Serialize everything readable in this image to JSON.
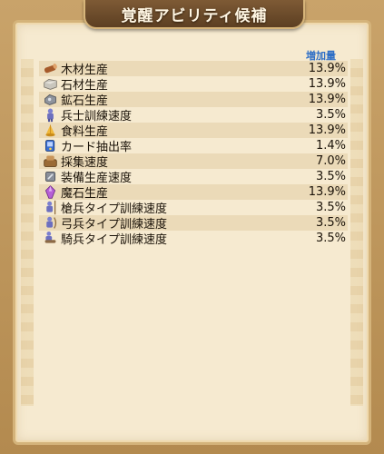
{
  "title": "覚醒アビリティ候補",
  "column_header": "増加量",
  "items": [
    {
      "icon": "wood-log-icon",
      "label": "木材生産",
      "value": "13.9%"
    },
    {
      "icon": "stone-block-icon",
      "label": "石材生産",
      "value": "13.9%"
    },
    {
      "icon": "ore-icon",
      "label": "鉱石生産",
      "value": "13.9%"
    },
    {
      "icon": "soldier-icon",
      "label": "兵士訓練速度",
      "value": "3.5%"
    },
    {
      "icon": "food-icon",
      "label": "食料生産",
      "value": "13.9%"
    },
    {
      "icon": "gacha-icon",
      "label": "カード抽出率",
      "value": "1.4%"
    },
    {
      "icon": "gathering-icon",
      "label": "採集速度",
      "value": "7.0%"
    },
    {
      "icon": "equipment-icon",
      "label": "装備生産速度",
      "value": "3.5%"
    },
    {
      "icon": "magic-stone-icon",
      "label": "魔石生産",
      "value": "13.9%"
    },
    {
      "icon": "spearman-icon",
      "label": "槍兵タイプ訓練速度",
      "value": "3.5%"
    },
    {
      "icon": "archer-icon",
      "label": "弓兵タイプ訓練速度",
      "value": "3.5%"
    },
    {
      "icon": "cavalry-icon",
      "label": "騎兵タイプ訓練速度",
      "value": "3.5%"
    }
  ],
  "colors": {
    "header_blue": "#2f6fc6",
    "panel_bg": "#f6ead0",
    "frame": "#b38a4f"
  }
}
